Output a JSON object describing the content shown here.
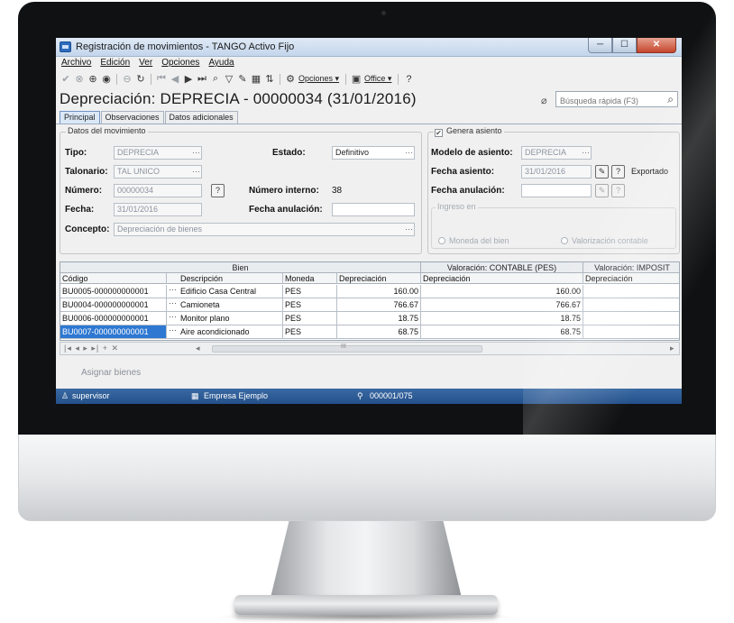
{
  "window": {
    "title": "Registración de movimientos - TANGO Activo Fijo",
    "min": "─",
    "max": "☐",
    "close": "✕"
  },
  "menu": [
    "Archivo",
    "Edición",
    "Ver",
    "Opciones",
    "Ayuda"
  ],
  "toolbar": {
    "opciones_label": "Opciones ▾",
    "office_label": "Office ▾",
    "help": "?"
  },
  "document_title": "Depreciación: DEPRECIA - 00000034 (31/01/2016)",
  "search": {
    "placeholder": "Búsqueda rápida (F3)"
  },
  "tabs": [
    "Principal",
    "Observaciones",
    "Datos adicionales"
  ],
  "movement": {
    "legend": "Datos del movimiento",
    "tipo_label": "Tipo:",
    "tipo_value": "DEPRECIA",
    "talonario_label": "Talonario:",
    "talonario_value": "TAL UNICO",
    "numero_label": "Número:",
    "numero_value": "00000034",
    "fecha_label": "Fecha:",
    "fecha_value": "31/01/2016",
    "concepto_label": "Concepto:",
    "concepto_value": "Depreciación de bienes",
    "estado_label": "Estado:",
    "estado_value": "Definitivo",
    "numero_interno_label": "Número interno:",
    "numero_interno_value": "38",
    "fecha_anulacion_label": "Fecha anulación:",
    "fecha_anulacion_value": ""
  },
  "asiento": {
    "legend": "Genera asiento",
    "checked": true,
    "modelo_label": "Modelo de asiento:",
    "modelo_value": "DEPRECIA",
    "fecha_label": "Fecha asiento:",
    "fecha_value": "31/01/2016",
    "exportado": "Exportado",
    "anulacion_label": "Fecha anulación:",
    "anulacion_value": "",
    "ingreso_legend": "Ingreso en",
    "radio1": "Moneda del bien",
    "radio2": "Valorización contable"
  },
  "grid": {
    "group_headers": [
      "Bien",
      "Valoración: CONTABLE (PES)",
      "Valoración: IMPOSIT"
    ],
    "columns": [
      "Código",
      "Descripción",
      "Moneda",
      "Depreciación",
      "Depreciación",
      "Depreciación"
    ],
    "rows": [
      {
        "codigo": "BU0005-000000000001",
        "descripcion": "Edificio Casa Central",
        "moneda": "PES",
        "dep": "160.00",
        "dep_contable": "160.00"
      },
      {
        "codigo": "BU0004-000000000001",
        "descripcion": "Camioneta",
        "moneda": "PES",
        "dep": "766.67",
        "dep_contable": "766.67"
      },
      {
        "codigo": "BU0006-000000000001",
        "descripcion": "Monitor plano",
        "moneda": "PES",
        "dep": "18.75",
        "dep_contable": "18.75"
      },
      {
        "codigo": "BU0007-000000000001",
        "descripcion": "Aire acondicionado",
        "moneda": "PES",
        "dep": "68.75",
        "dep_contable": "68.75"
      }
    ],
    "nav_buttons": "|◂  ◂  ▸  ▸|  +  ✕",
    "scroll_mark": "III"
  },
  "assign_label": "Asignar bienes",
  "status": {
    "user": "supervisor",
    "company": "Empresa Ejemplo",
    "counter": "000001/075"
  }
}
